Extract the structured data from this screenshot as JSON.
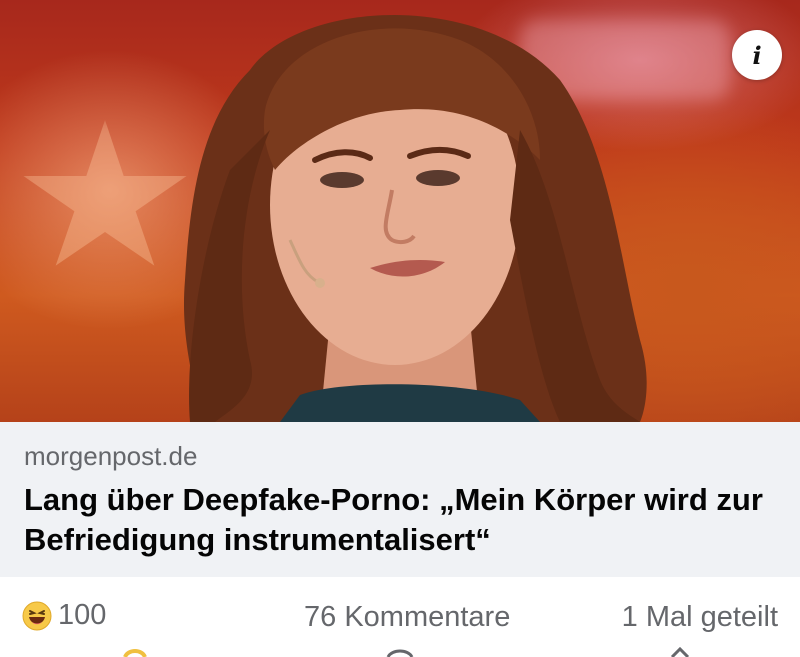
{
  "post": {
    "photo_alt": "",
    "info_icon": "info-icon",
    "info_glyph": "i",
    "link": {
      "domain": "morgenpost.de",
      "title": "Lang über Deepfake-Porno: „Mein Körper wird zur Befriedigung instrumentalisert“"
    },
    "stats": {
      "reaction_icon": "laughing-emoji-icon",
      "reaction_count": "100",
      "comments": "76 Kommentare",
      "shares": "1 Mal geteilt"
    }
  },
  "colors": {
    "caption_bg": "#f0f2f5",
    "secondary_text": "#65676b",
    "title_text": "#050505",
    "photo_bg": "#bf3a1b"
  }
}
